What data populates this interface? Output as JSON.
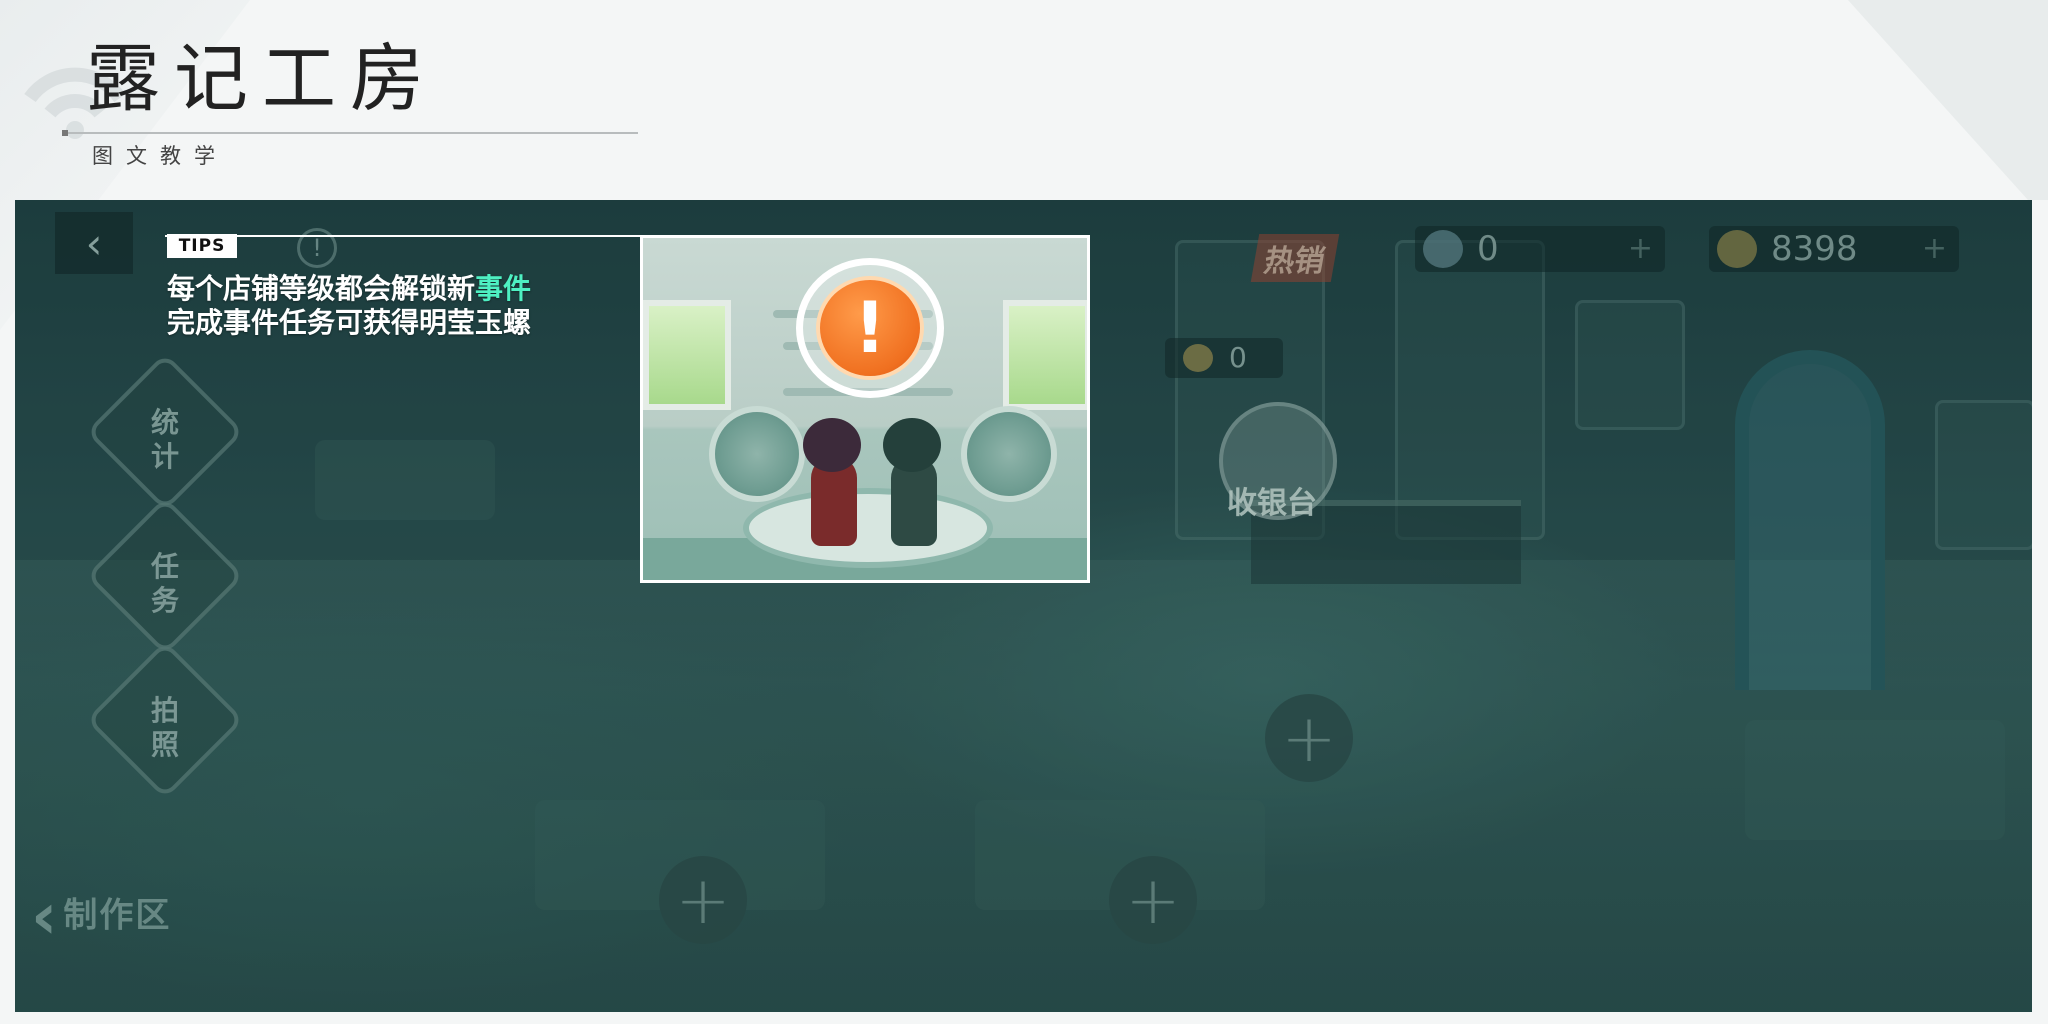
{
  "page": {
    "title": "露记工房",
    "subtitle": "图文教学"
  },
  "game": {
    "back_icon": "chevron-left-icon",
    "info_icon": "info-icon",
    "side_buttons": [
      {
        "id": "stats",
        "label_line1": "统",
        "label_line2": "计"
      },
      {
        "id": "task",
        "label_line1": "任",
        "label_line2": "务"
      },
      {
        "id": "photo",
        "label_line1": "拍",
        "label_line2": "照"
      }
    ],
    "craft_zone_label": "制作区",
    "hot_badge": "热销",
    "currency_1": {
      "value": "0",
      "icon": "shell-icon"
    },
    "currency_2": {
      "value": "8398",
      "icon": "coin-icon"
    },
    "bubble_value": "0",
    "cashier_label": "收银台",
    "add_symbol": "+",
    "colors": {
      "highlight": "#4ef0c2",
      "alert": "#f07020"
    }
  },
  "tips": {
    "tag": "TIPS",
    "line1_prefix": "每个店铺等级都会解锁新",
    "line1_highlight": "事件",
    "line2": "完成事件任务可获得明莹玉螺",
    "alert_symbol": "!"
  }
}
